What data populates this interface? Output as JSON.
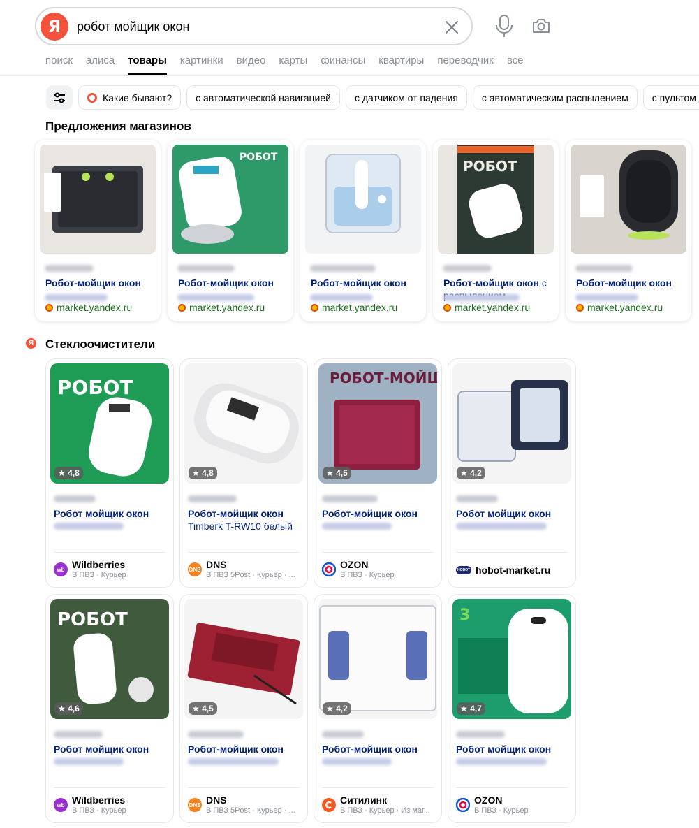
{
  "search": {
    "query": "робот мойщик окон",
    "logo": "Я"
  },
  "nav": {
    "items": [
      "поиск",
      "алиса",
      "товары",
      "картинки",
      "видео",
      "карты",
      "финансы",
      "квартиры",
      "переводчик",
      "все"
    ],
    "active": "товары"
  },
  "chips": [
    "Какие бывают?",
    "с автоматической навигацией",
    "с датчиком от падения",
    "с автоматическим распылением",
    "с пультом Д"
  ],
  "offers": {
    "heading": "Предложения магазинов",
    "items": [
      {
        "title": "Робот-мойщик окон",
        "rest": "",
        "source": "market.yandex.ru",
        "art": "dark-square"
      },
      {
        "title": "Робот-мойщик окон",
        "rest": "",
        "source": "market.yandex.ru",
        "art": "green-poster"
      },
      {
        "title": "Робот-мойщик окон",
        "rest": "",
        "source": "market.yandex.ru",
        "art": "white-tank"
      },
      {
        "title": "Робот-мойщик окон",
        "rest": " с распылением",
        "source": "market.yandex.ru",
        "art": "poster-white"
      },
      {
        "title": "Робот-мойщик окон",
        "rest": "",
        "source": "market.yandex.ru",
        "art": "black-oval"
      }
    ]
  },
  "glass": {
    "heading": "Стеклоочистители",
    "section_logo": "Я",
    "cards": [
      {
        "rating": "4,8",
        "title": "Робот мойщик окон",
        "desc": "",
        "shop": "Wildberries",
        "shop_sub": "В ПВЗ · Курьер",
        "shop_icon": "wildberries",
        "shop_color": "#9b2fd1",
        "shop_abbr": "wb"
      },
      {
        "rating": "4,8",
        "title": "Робот-мойщик окон",
        "desc": "Timberk T-RW10 белый",
        "shop": "DNS",
        "shop_sub": "В ПВЗ 5Post · Курьер · ...",
        "shop_icon": "dns",
        "shop_color": "#f58220",
        "shop_abbr": "DNS"
      },
      {
        "rating": "4,5",
        "title": "Робот-мойщик окон",
        "desc": "",
        "shop": "OZON",
        "shop_sub": "В ПВЗ · Курьер",
        "shop_icon": "ozon",
        "shop_color": "#ffffff",
        "shop_abbr": ""
      },
      {
        "rating": "4,2",
        "title": "Робот мойщик окон",
        "desc": "",
        "shop": "hobot-market.ru",
        "shop_sub": "",
        "shop_icon": "hobot",
        "shop_color": "#1b2a6b",
        "shop_abbr": "HOBOT"
      },
      {
        "rating": "4,6",
        "title": "Робот мойщик окон",
        "desc": "",
        "shop": "Wildberries",
        "shop_sub": "В ПВЗ · Курьер",
        "shop_icon": "wildberries",
        "shop_color": "#9b2fd1",
        "shop_abbr": "wb"
      },
      {
        "rating": "4,5",
        "title": "Робот-мойщик окон",
        "desc": "",
        "shop": "DNS",
        "shop_sub": "В ПВЗ 5Post · Курьер · ...",
        "shop_icon": "dns",
        "shop_color": "#f58220",
        "shop_abbr": "DNS"
      },
      {
        "rating": "4,2",
        "title": "Робот-мойщик окон",
        "desc": "",
        "shop": "Ситилинк",
        "shop_sub": "В ПВЗ · Курьер · Из маг...",
        "shop_icon": "citilink",
        "shop_color": "#f05a22",
        "shop_abbr": ""
      },
      {
        "rating": "4,7",
        "title": "Робот мойщик окон",
        "desc": "",
        "shop": "OZON",
        "shop_sub": "В ПВЗ · Курьер",
        "shop_icon": "ozon",
        "shop_color": "#ffffff",
        "shop_abbr": ""
      }
    ]
  }
}
